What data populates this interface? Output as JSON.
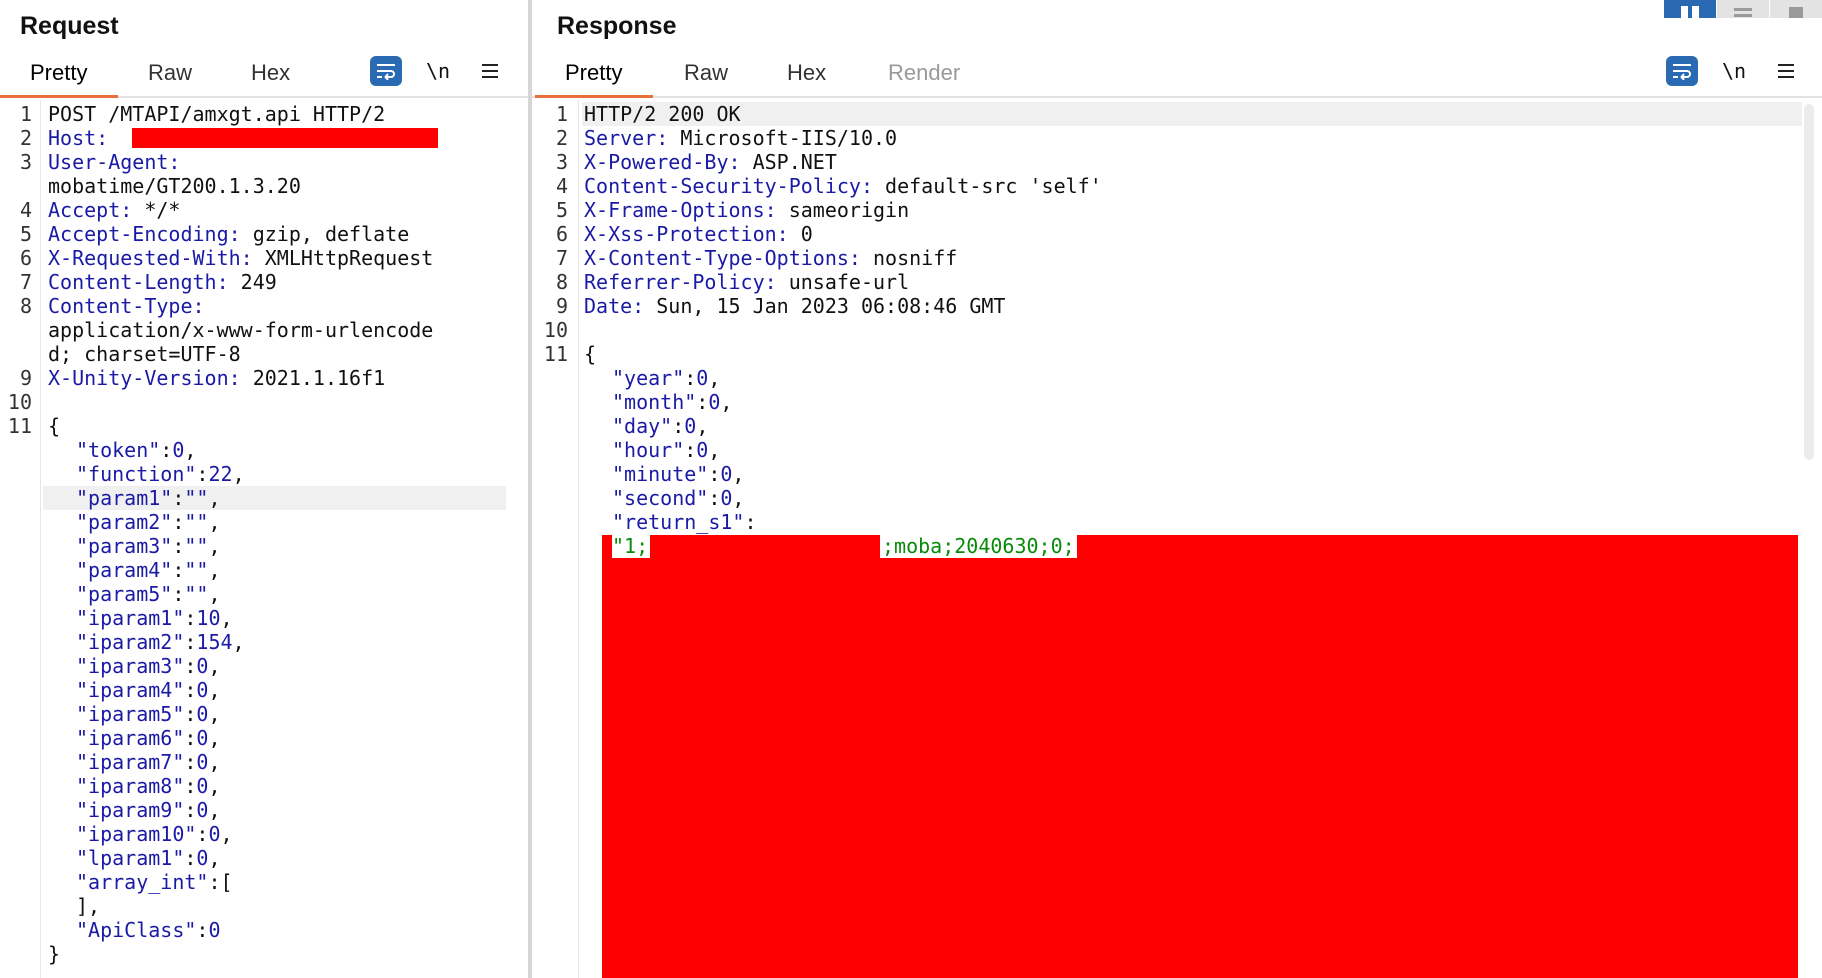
{
  "request": {
    "title": "Request",
    "tabs": [
      "Pretty",
      "Raw",
      "Hex"
    ],
    "active_tab": "Pretty",
    "newline_toggle": "\\n",
    "line_numbers": [
      "1",
      "2",
      "3",
      "4",
      "5",
      "6",
      "7",
      "8",
      "9",
      "10",
      "11"
    ],
    "lines": {
      "l1": "POST /MTAPI/amxgt.api HTTP/2",
      "l2k": "Host:",
      "l3k": "User-Agent:",
      "l3v": "mobatime/GT200.1.3.20",
      "l4k": "Accept:",
      "l4v": " */*",
      "l5k": "Accept-Encoding:",
      "l5v": " gzip, deflate",
      "l6k": "X-Requested-With:",
      "l6v": " XMLHttpRequest",
      "l7k": "Content-Length:",
      "l7v": " 249",
      "l8k": "Content-Type:",
      "l8v1": "application/x-www-form-urlencode",
      "l8v2": "d; charset=UTF-8",
      "l9k": "X-Unity-Version:",
      "l9v": " 2021.1.16f1"
    },
    "body": {
      "open": "{",
      "token_k": "\"token\"",
      "token_v": "0",
      "function_k": "\"function\"",
      "function_v": "22",
      "param1_k": "\"param1\"",
      "param1_v": "\"\"",
      "param2_k": "\"param2\"",
      "param2_v": "\"\"",
      "param3_k": "\"param3\"",
      "param3_v": "\"\"",
      "param4_k": "\"param4\"",
      "param4_v": "\"\"",
      "param5_k": "\"param5\"",
      "param5_v": "\"\"",
      "iparam1_k": "\"iparam1\"",
      "iparam1_v": "10",
      "iparam2_k": "\"iparam2\"",
      "iparam2_v": "154",
      "iparam3_k": "\"iparam3\"",
      "iparam3_v": "0",
      "iparam4_k": "\"iparam4\"",
      "iparam4_v": "0",
      "iparam5_k": "\"iparam5\"",
      "iparam5_v": "0",
      "iparam6_k": "\"iparam6\"",
      "iparam6_v": "0",
      "iparam7_k": "\"iparam7\"",
      "iparam7_v": "0",
      "iparam8_k": "\"iparam8\"",
      "iparam8_v": "0",
      "iparam9_k": "\"iparam9\"",
      "iparam9_v": "0",
      "iparam10_k": "\"iparam10\"",
      "iparam10_v": "0",
      "lparam1_k": "\"lparam1\"",
      "lparam1_v": "0",
      "array_int_k": "\"array_int\"",
      "array_open": "[",
      "array_close": "]",
      "apiclass_k": "\"ApiClass\"",
      "apiclass_v": "0",
      "close": "}"
    }
  },
  "response": {
    "title": "Response",
    "tabs": [
      "Pretty",
      "Raw",
      "Hex",
      "Render"
    ],
    "active_tab": "Pretty",
    "newline_toggle": "\\n",
    "line_numbers": [
      "1",
      "2",
      "3",
      "4",
      "5",
      "6",
      "7",
      "8",
      "9",
      "10",
      "11"
    ],
    "lines": {
      "l1": "HTTP/2 200 OK",
      "l2k": "Server:",
      "l2v": " Microsoft-IIS/10.0",
      "l3k": "X-Powered-By:",
      "l3v": " ASP.NET",
      "l4k": "Content-Security-Policy:",
      "l4v": " default-src 'self'",
      "l5k": "X-Frame-Options:",
      "l5v": " sameorigin",
      "l6k": "X-Xss-Protection:",
      "l6v": " 0",
      "l7k": "X-Content-Type-Options:",
      "l7v": " nosniff",
      "l8k": "Referrer-Policy:",
      "l8v": " unsafe-url",
      "l9k": "Date:",
      "l9v": " Sun, 15 Jan 2023 06:08:46 GMT"
    },
    "body": {
      "open": "{",
      "year_k": "\"year\"",
      "year_v": "0",
      "month_k": "\"month\"",
      "month_v": "0",
      "day_k": "\"day\"",
      "day_v": "0",
      "hour_k": "\"hour\"",
      "hour_v": "0",
      "minute_k": "\"minute\"",
      "minute_v": "0",
      "second_k": "\"second\"",
      "second_v": "0",
      "return_s1_k": "\"return_s1\"",
      "return_s1_v_start": "\"1;",
      "return_s1_v_end": ";moba;2040630;0;"
    }
  },
  "colors": {
    "accent_tab": "#e8703a",
    "toolbar_blue": "#2a6ab3",
    "key_blue": "#1a1aa6",
    "string_green": "#0a8a0a",
    "redaction": "#ff0000"
  },
  "icons": [
    "wrap-lines-icon",
    "newline-toggle",
    "menu-icon",
    "layout-split-icon",
    "layout-stack-icon",
    "layout-single-icon"
  ]
}
